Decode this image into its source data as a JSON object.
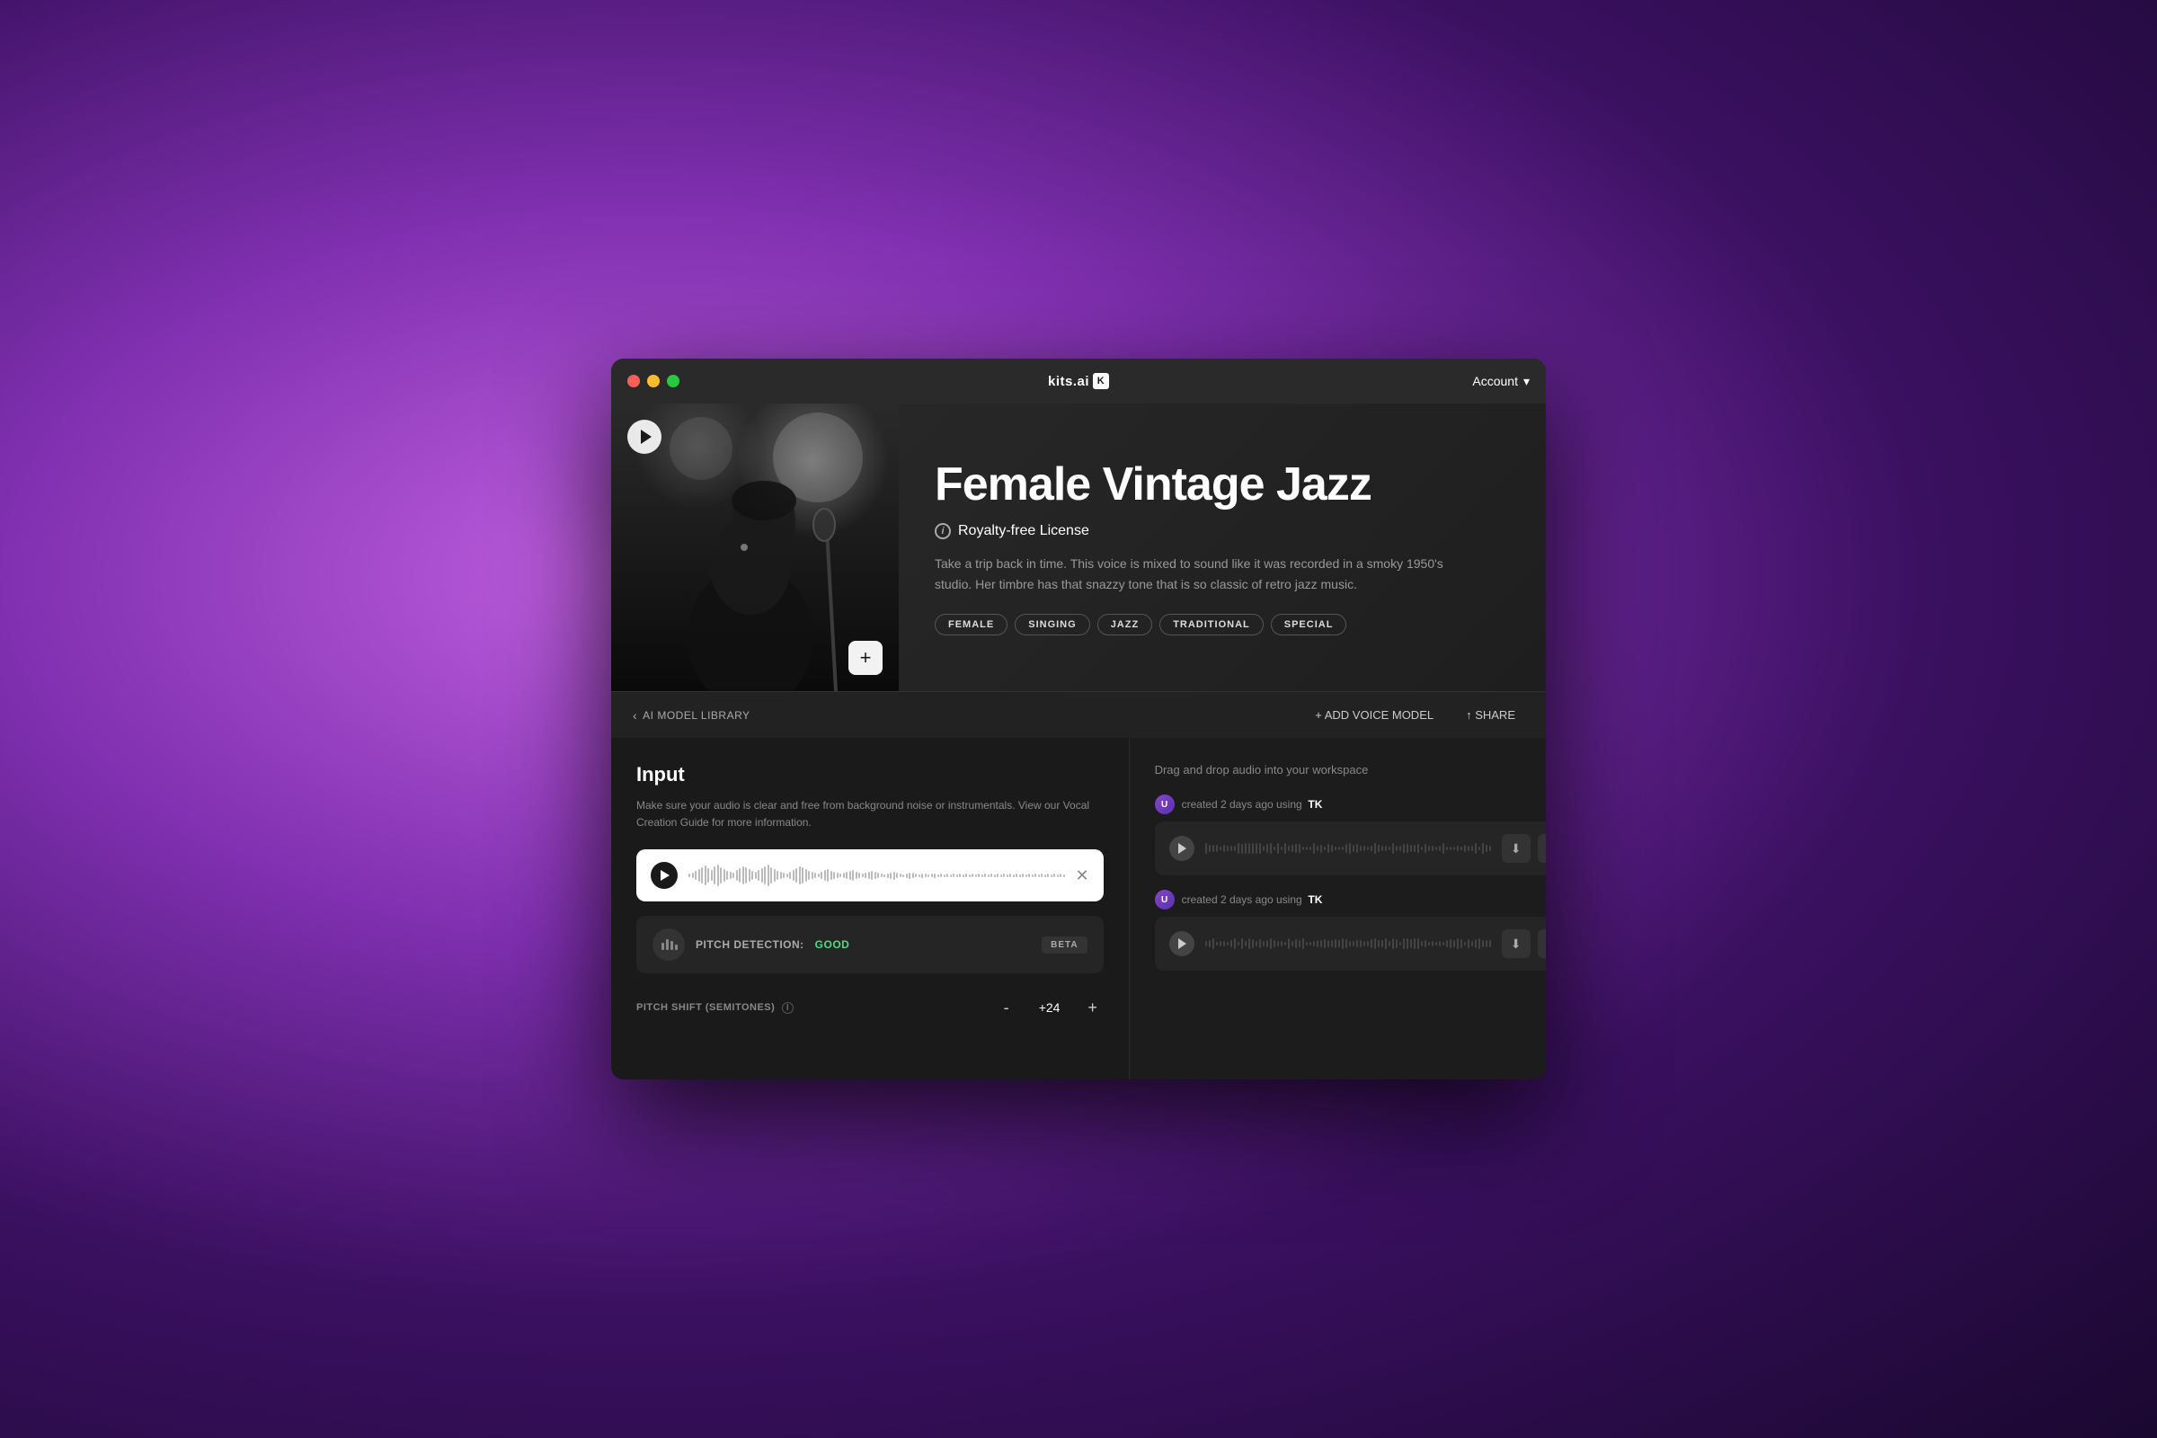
{
  "window": {
    "controls": {
      "close_label": "●",
      "min_label": "●",
      "max_label": "●"
    },
    "titlebar": {
      "logo_text": "kits.ai",
      "logo_icon": "K",
      "account_label": "Account"
    }
  },
  "hero": {
    "title": "Female Vintage Jazz",
    "license": "Royalty-free License",
    "description": "Take a trip back in time. This voice is mixed to sound like it was recorded in a smoky 1950's studio. Her timbre has that snazzy tone that is so classic of retro jazz music.",
    "tags": [
      "FEMALE",
      "SINGING",
      "JAZZ",
      "TRADITIONAL",
      "SPECIAL"
    ],
    "add_btn_label": "+"
  },
  "toolbar": {
    "back_label": "AI MODEL LIBRARY",
    "add_voice_label": "+ ADD VOICE MODEL",
    "share_label": "↑ SHARE"
  },
  "input_panel": {
    "title": "Input",
    "description": "Make sure your audio is clear and free from background noise or instrumentals. View our Vocal Creation Guide for more information.",
    "pitch_detection_label": "PITCH DETECTION:",
    "pitch_detection_value": "GOOD",
    "beta_label": "BETA",
    "pitch_shift_label": "PITCH SHIFT (SEMITONES)",
    "pitch_value": "+24",
    "pitch_minus": "-",
    "pitch_plus": "+"
  },
  "output_panel": {
    "drag_drop_text": "Drag and drop audio into your workspace",
    "items": [
      {
        "meta_prefix": "created 2 days ago using",
        "meta_user": "TK"
      },
      {
        "meta_prefix": "created 2 days ago using",
        "meta_user": "TK"
      }
    ]
  },
  "icons": {
    "play": "▶",
    "close": "✕",
    "chevron_down": "▾",
    "chevron_left": "‹",
    "download": "⬇",
    "share_icon": "↑",
    "add": "+",
    "copy": "⧉"
  },
  "colors": {
    "accent_green": "#4ade80",
    "bg_dark": "#1a1a1a",
    "bg_medium": "#252525",
    "text_muted": "#888888",
    "text_white": "#ffffff"
  }
}
